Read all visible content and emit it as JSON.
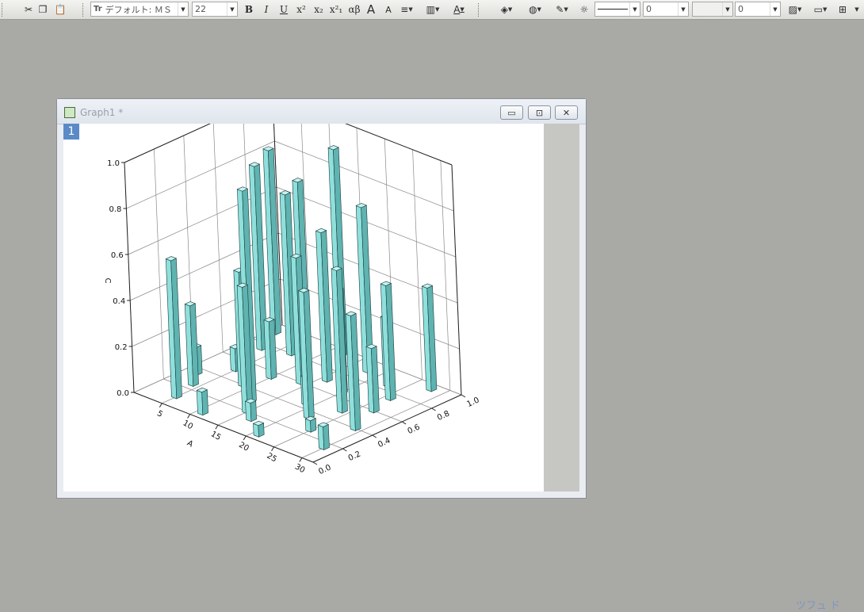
{
  "toolbar": {
    "font_name": "デフォルト: ＭＳ",
    "font_size": "22",
    "bold": "B",
    "italic": "I",
    "underline": "U",
    "greek": "αβ",
    "line_width": "0",
    "pattern_width": "0",
    "font_icon_glyph": "Tr"
  },
  "window": {
    "title": "Graph1 *",
    "layer_label": "1"
  },
  "bottom_text": "ツフュ ド",
  "chart_data": {
    "type": "bar3d",
    "title": "",
    "xlabel": "A",
    "ylabel": "",
    "zlabel": "C",
    "x_ticks": [
      "5",
      "10",
      "15",
      "20",
      "25",
      "30"
    ],
    "y_ticks": [
      "0.0",
      "0.2",
      "0.4",
      "0.6",
      "0.8",
      "1.0"
    ],
    "z_ticks": [
      "0.0",
      "0.2",
      "0.4",
      "0.6",
      "0.8",
      "1.0"
    ],
    "xlim": [
      0,
      32
    ],
    "ylim": [
      0,
      1
    ],
    "zlim": [
      0,
      1
    ],
    "bar_color": "#8fe0dc",
    "points": [
      {
        "x": 1,
        "y": 0.92,
        "z": 0.8
      },
      {
        "x": 2,
        "y": 0.35,
        "z": 0.12
      },
      {
        "x": 3,
        "y": 0.75,
        "z": 0.8
      },
      {
        "x": 4,
        "y": 0.25,
        "z": 0.35
      },
      {
        "x": 5,
        "y": 0.1,
        "z": 0.6
      },
      {
        "x": 5,
        "y": 0.5,
        "z": 0.1
      },
      {
        "x": 7,
        "y": 0.8,
        "z": 0.7
      },
      {
        "x": 8,
        "y": 0.85,
        "z": 0.75
      },
      {
        "x": 9,
        "y": 0.4,
        "z": 0.5
      },
      {
        "x": 10,
        "y": 0.55,
        "z": 0.25
      },
      {
        "x": 11,
        "y": 0.05,
        "z": 0.1
      },
      {
        "x": 12,
        "y": 0.95,
        "z": 0.9
      },
      {
        "x": 13,
        "y": 0.3,
        "z": 0.92
      },
      {
        "x": 14,
        "y": 0.6,
        "z": 0.55
      },
      {
        "x": 15,
        "y": 0.2,
        "z": 0.55
      },
      {
        "x": 16,
        "y": 0.7,
        "z": 0.65
      },
      {
        "x": 17,
        "y": 0.15,
        "z": 0.08
      },
      {
        "x": 18,
        "y": 0.9,
        "z": 0.72
      },
      {
        "x": 19,
        "y": 0.45,
        "z": 0.12
      },
      {
        "x": 20,
        "y": 0.65,
        "z": 0.45
      },
      {
        "x": 21,
        "y": 0.05,
        "z": 0.05
      },
      {
        "x": 22,
        "y": 0.35,
        "z": 0.55
      },
      {
        "x": 23,
        "y": 0.85,
        "z": 0.3
      },
      {
        "x": 24,
        "y": 0.5,
        "z": 0.62
      },
      {
        "x": 25,
        "y": 0.25,
        "z": 0.05
      },
      {
        "x": 26,
        "y": 0.75,
        "z": 0.5
      },
      {
        "x": 27,
        "y": 0.6,
        "z": 0.28
      },
      {
        "x": 28,
        "y": 0.95,
        "z": 0.45
      },
      {
        "x": 29,
        "y": 0.4,
        "z": 0.5
      },
      {
        "x": 30,
        "y": 0.15,
        "z": 0.1
      }
    ]
  }
}
